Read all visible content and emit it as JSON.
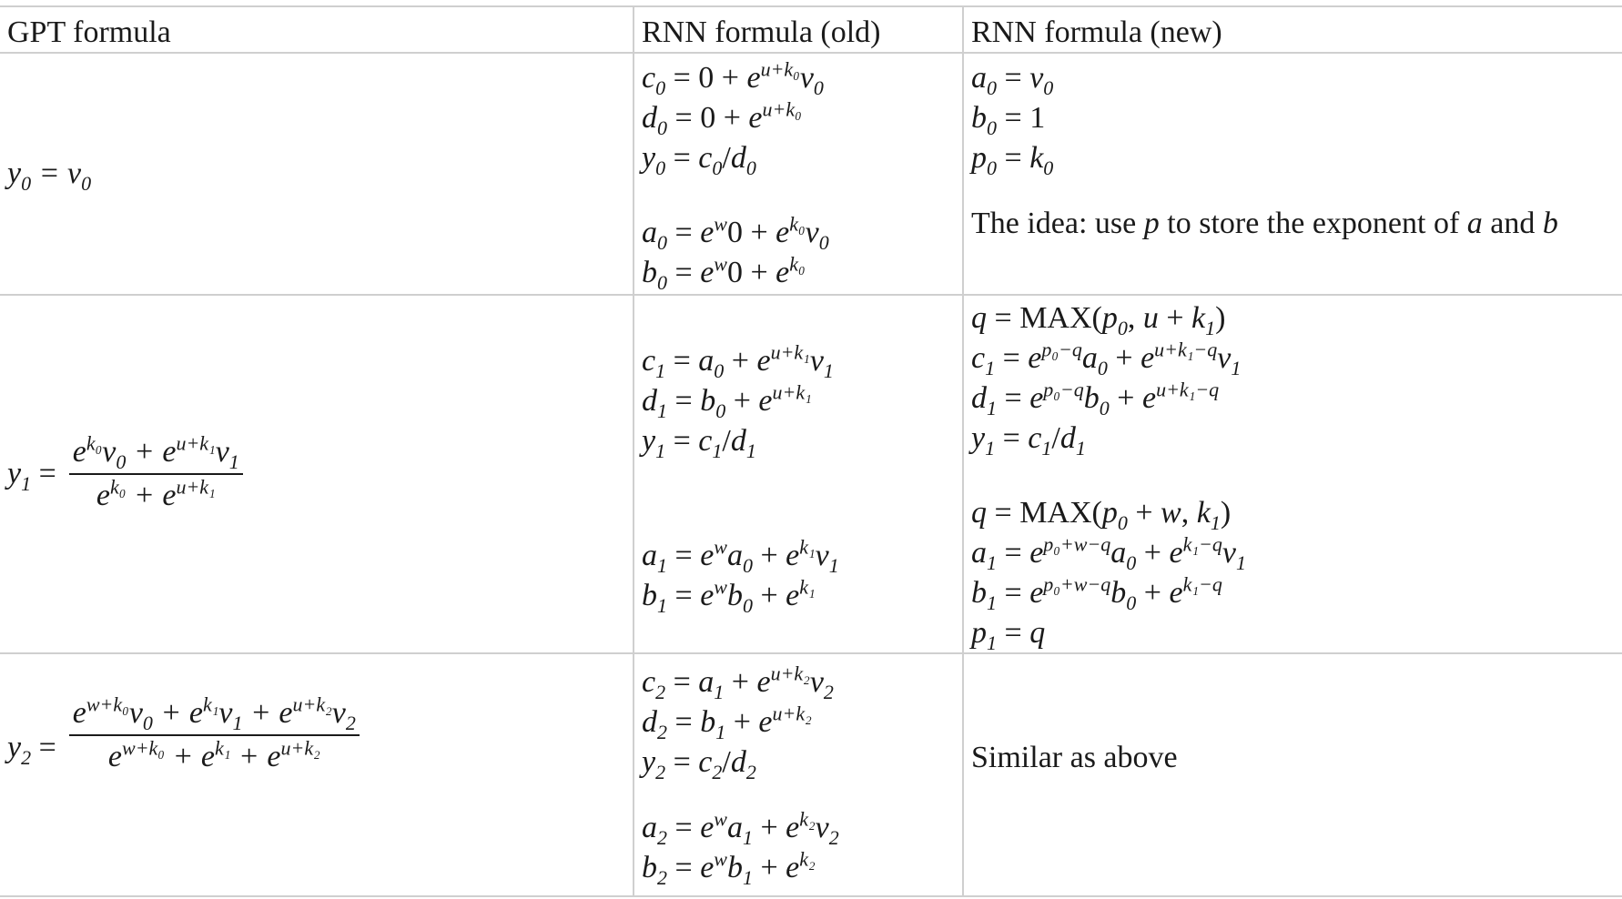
{
  "headers": {
    "gpt": "GPT formula",
    "rnn_old": "RNN formula (old)",
    "rnn_new": "RNN formula (new)"
  },
  "gpt": {
    "row0": {
      "lhs": "y",
      "lhs_sub": "0",
      "rhs": " = v",
      "rhs_sub": "0"
    },
    "row1": {
      "lhs": "y",
      "lhs_sub": "1",
      "eq": "=",
      "num": [
        "e",
        "k₀",
        "v",
        "0",
        " + e",
        "u+k₁",
        "v",
        "1"
      ],
      "den": [
        "e",
        "k₀",
        " + e",
        "u+k₁"
      ]
    },
    "row2": {
      "lhs": "y",
      "lhs_sub": "2",
      "eq": "=",
      "num": [
        "e",
        "w+k₀",
        "v",
        "0",
        " + e",
        "k₁",
        "v",
        "1",
        " + e",
        "u+k₂",
        "v",
        "2"
      ],
      "den": [
        "e",
        "w+k₀",
        " + e",
        "k₁",
        " + e",
        "u+k₂"
      ]
    }
  },
  "rnn_old": {
    "row0": [
      "c₀ = 0 + e^{u+k₀}v₀",
      "d₀ = 0 + e^{u+k₀}",
      "y₀ = c₀/d₀",
      "a₀ = e^{w}0 + e^{k₀}v₀",
      "b₀ = e^{w}0 + e^{k₀}"
    ],
    "row1": [
      "c₁ = a₀ + e^{u+k₁}v₁",
      "d₁ = b₀ + e^{u+k₁}",
      "y₁ = c₁/d₁",
      "a₁ = e^{w}a₀ + e^{k₁}v₁",
      "b₁ = e^{w}b₀ + e^{k₁}"
    ],
    "row2": [
      "c₂ = a₁ + e^{u+k₂}v₂",
      "d₂ = b₁ + e^{u+k₂}",
      "y₂ = c₂/d₂",
      "a₂ = e^{w}a₁ + e^{k₂}v₂",
      "b₂ = e^{w}b₁ + e^{k₂}"
    ]
  },
  "rnn_new": {
    "row0": [
      "a₀ = v₀",
      "b₀ = 1",
      "p₀ = k₀"
    ],
    "row0_note": [
      "The idea: use ",
      "p",
      " to store the exponent of ",
      "a",
      " and ",
      "b"
    ],
    "row1": [
      "q = MAX(p₀, u + k₁)",
      "c₁ = e^{p₀−q}a₀ + e^{u+k₁−q}v₁",
      "d₁ = e^{p₀−q}b₀ + e^{u+k₁−q}",
      "y₁ = c₁/d₁",
      "q = MAX(p₀ + w, k₁)",
      "a₁ = e^{p₀+w−q}a₀ + e^{k₁−q}v₁",
      "b₁ = e^{p₀+w−q}b₀ + e^{k₁−q}",
      "p₁ = q"
    ],
    "row2_note": "Similar as above"
  }
}
